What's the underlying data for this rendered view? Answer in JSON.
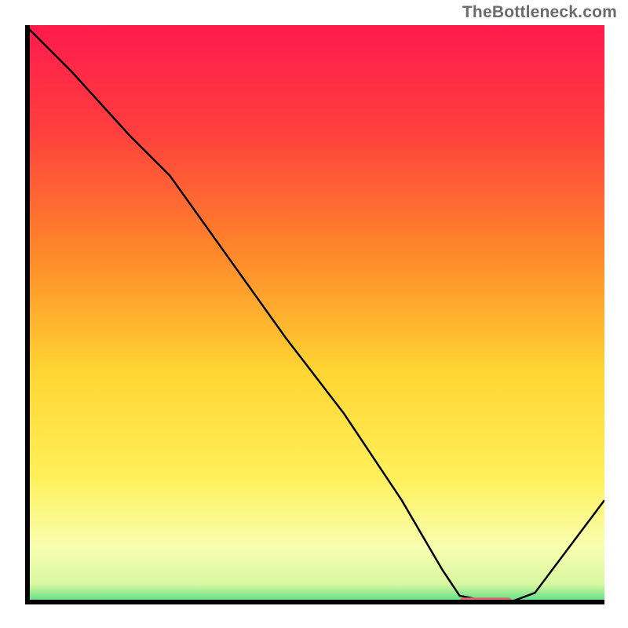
{
  "watermark": "TheBottleneck.com",
  "chart_data": {
    "type": "line",
    "title": "",
    "xlabel": "",
    "ylabel": "",
    "xlim": [
      0,
      100
    ],
    "ylim": [
      0,
      100
    ],
    "x": [
      0,
      8,
      18,
      25,
      35,
      45,
      55,
      65,
      72,
      75,
      80,
      84,
      88,
      100
    ],
    "values": [
      100,
      92,
      81,
      74,
      60,
      46,
      33,
      18,
      6,
      1.5,
      0.5,
      0.5,
      2,
      18
    ],
    "marker_segment": {
      "x_start": 75,
      "x_end": 84,
      "y": 0.5,
      "color": "#e06a6a"
    },
    "background_gradient_stops": [
      {
        "offset": 0.0,
        "color": "#ff1a4d"
      },
      {
        "offset": 0.18,
        "color": "#ff3e3e"
      },
      {
        "offset": 0.4,
        "color": "#ff8a2a"
      },
      {
        "offset": 0.6,
        "color": "#ffd633"
      },
      {
        "offset": 0.78,
        "color": "#fff05a"
      },
      {
        "offset": 0.9,
        "color": "#f9ffb0"
      },
      {
        "offset": 0.965,
        "color": "#d8f7a0"
      },
      {
        "offset": 0.99,
        "color": "#6fe38a"
      },
      {
        "offset": 1.0,
        "color": "#17d46a"
      }
    ]
  }
}
